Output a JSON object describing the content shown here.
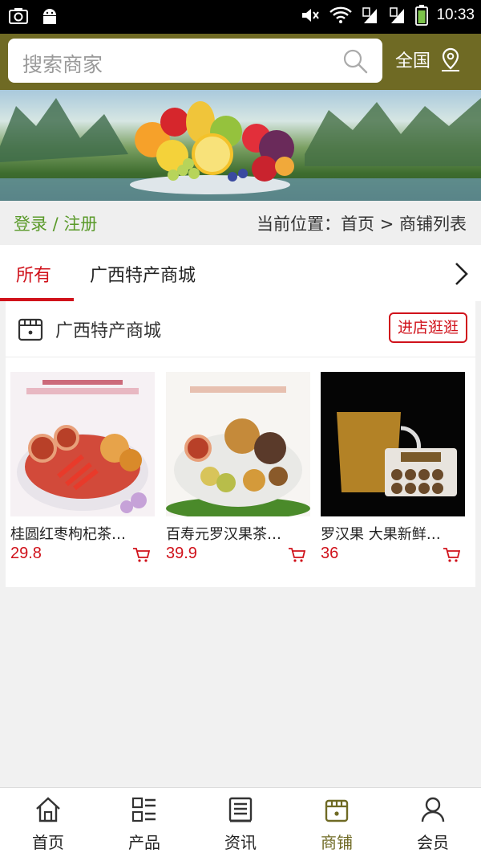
{
  "status_bar": {
    "time": "10:33"
  },
  "search": {
    "placeholder": "搜索商家"
  },
  "region": {
    "label": "全国"
  },
  "location_bar": {
    "login_label": "登录 / 注册",
    "breadcrumb": "当前位置：首页 > 商铺列表"
  },
  "tabs": [
    {
      "label": "所有",
      "active": true
    },
    {
      "label": "广西特产商城",
      "active": false
    }
  ],
  "store": {
    "name": "广西特产商城",
    "visit_label": "进店逛逛",
    "products": [
      {
        "name": "桂圆红枣枸杞茶…",
        "price": "29.8"
      },
      {
        "name": "百寿元罗汉果茶…",
        "price": "39.9"
      },
      {
        "name": "罗汉果 大果新鲜…",
        "price": "36"
      }
    ]
  },
  "bottom_nav": [
    {
      "label": "首页",
      "icon": "home-icon"
    },
    {
      "label": "产品",
      "icon": "grid-list-icon"
    },
    {
      "label": "资讯",
      "icon": "news-icon"
    },
    {
      "label": "商铺",
      "icon": "shop-icon",
      "active": true
    },
    {
      "label": "会员",
      "icon": "user-icon"
    }
  ],
  "colors": {
    "header_bg": "#6f6a24",
    "accent_red": "#d0121b",
    "login_green": "#5a9a2a",
    "active_nav": "#6f6a24"
  }
}
